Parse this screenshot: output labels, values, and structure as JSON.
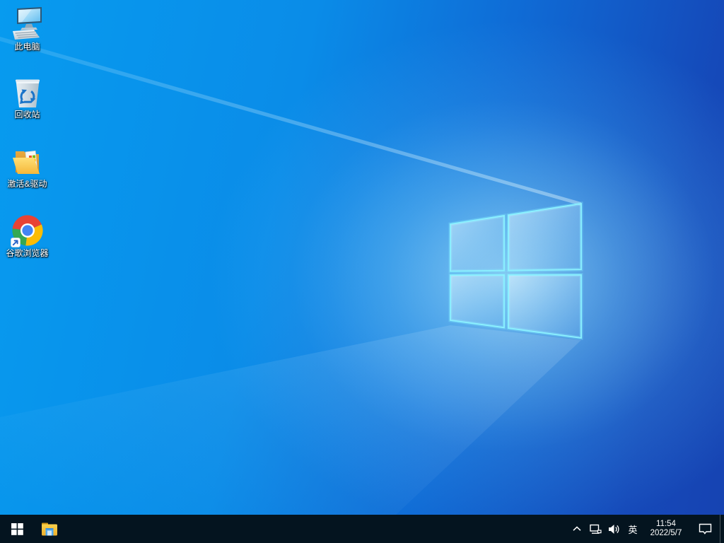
{
  "desktop": {
    "icons": [
      {
        "name": "this-pc",
        "label": "此电脑"
      },
      {
        "name": "recycle-bin",
        "label": "回收站"
      },
      {
        "name": "activation-drivers",
        "label": "激活&驱动"
      },
      {
        "name": "google-chrome",
        "label": "谷歌浏览器"
      }
    ]
  },
  "taskbar": {
    "tray": {
      "ime": "英",
      "time": "11:54",
      "date": "2022/5/7"
    }
  },
  "colors": {
    "wallpaper_bright_left": "#0794ee",
    "wallpaper_cyan_bottom_left": "#06a8f0",
    "wallpaper_deep_right": "#1544b5",
    "logo_edge_glow": "#78eeff",
    "taskbar_background": "#04141f",
    "chrome_red": "#e84335",
    "chrome_green": "#34a853",
    "chrome_yellow": "#fbbc05",
    "chrome_blue": "#4285f4",
    "folder_yellow": "#fbd14b",
    "explorer_front_blue": "#52aaf0",
    "recycle_symbol_blue": "#1b74c8"
  }
}
